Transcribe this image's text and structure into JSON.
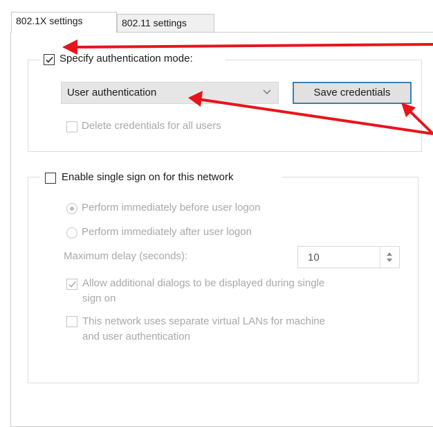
{
  "tabs": {
    "active": "802.1X settings",
    "inactive": "802.11 settings"
  },
  "auth_group": {
    "specify_mode_label": "Specify authentication mode:",
    "specify_mode_checked": true,
    "mode_select_value": "User authentication",
    "save_credentials_label": "Save credentials",
    "delete_credentials_label": "Delete credentials for all users",
    "delete_credentials_checked": false
  },
  "sso_group": {
    "enable_label": "Enable single sign on for this network",
    "enable_checked": false,
    "radio_before_label": "Perform immediately before user logon",
    "radio_after_label": "Perform immediately after user logon",
    "selected_radio": "before",
    "max_delay_label": "Maximum delay (seconds):",
    "max_delay_value": "10",
    "allow_dialogs_line1": "Allow additional dialogs to be displayed during single",
    "allow_dialogs_line2": "sign on",
    "allow_dialogs_checked": true,
    "separate_vlans_line1": "This network uses separate virtual LANs for machine",
    "separate_vlans_line2": "and user authentication",
    "separate_vlans_checked": false
  },
  "annotation_colors": {
    "arrow": "#e8141b"
  }
}
